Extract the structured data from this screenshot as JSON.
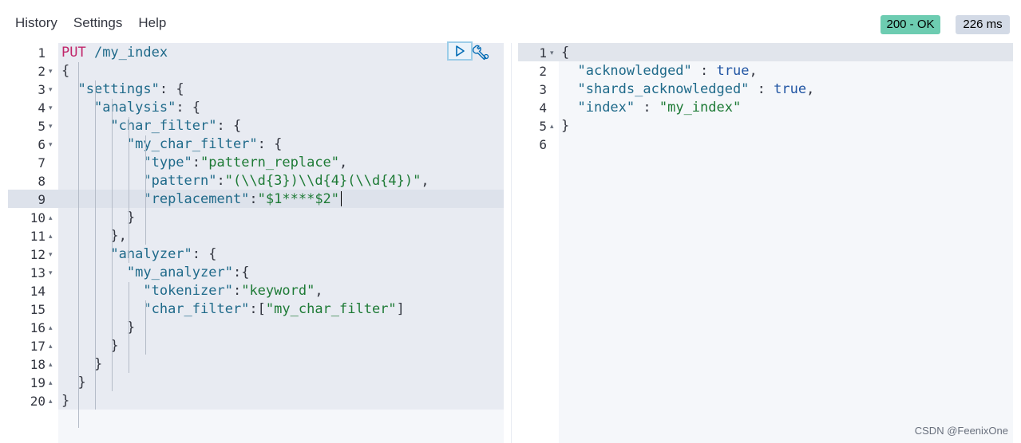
{
  "menu": {
    "items": [
      "History",
      "Settings",
      "Help"
    ]
  },
  "status": {
    "code": "200 - OK",
    "time": "226 ms",
    "ok_color": "#6dccb1"
  },
  "request": {
    "lines": [
      {
        "n": "1",
        "fold": "",
        "tokens": [
          [
            "kw",
            "PUT "
          ],
          [
            "key",
            "/my_index"
          ]
        ]
      },
      {
        "n": "2",
        "fold": "▾",
        "tokens": [
          [
            "pun",
            "{"
          ]
        ]
      },
      {
        "n": "3",
        "fold": "▾",
        "tokens": [
          [
            "pun",
            "  "
          ],
          [
            "key",
            "\"settings\""
          ],
          [
            "pun",
            ": {"
          ]
        ]
      },
      {
        "n": "4",
        "fold": "▾",
        "tokens": [
          [
            "pun",
            "    "
          ],
          [
            "key",
            "\"analysis\""
          ],
          [
            "pun",
            ": {"
          ]
        ]
      },
      {
        "n": "5",
        "fold": "▾",
        "tokens": [
          [
            "pun",
            "      "
          ],
          [
            "key",
            "\"char_filter\""
          ],
          [
            "pun",
            ": {"
          ]
        ]
      },
      {
        "n": "6",
        "fold": "▾",
        "tokens": [
          [
            "pun",
            "        "
          ],
          [
            "key",
            "\"my_char_filter\""
          ],
          [
            "pun",
            ": {"
          ]
        ]
      },
      {
        "n": "7",
        "fold": "",
        "tokens": [
          [
            "pun",
            "          "
          ],
          [
            "key",
            "\"type\""
          ],
          [
            "pun",
            ":"
          ],
          [
            "str",
            "\"pattern_replace\""
          ],
          [
            "pun",
            ","
          ]
        ]
      },
      {
        "n": "8",
        "fold": "",
        "tokens": [
          [
            "pun",
            "          "
          ],
          [
            "key",
            "\"pattern\""
          ],
          [
            "pun",
            ":"
          ],
          [
            "str",
            "\"(\\\\d{3})\\\\d{4}(\\\\d{4})\""
          ],
          [
            "pun",
            ","
          ]
        ]
      },
      {
        "n": "9",
        "fold": "",
        "tokens": [
          [
            "pun",
            "          "
          ],
          [
            "key",
            "\"replacement\""
          ],
          [
            "pun",
            ":"
          ],
          [
            "str",
            "\"$1****$2\""
          ]
        ]
      },
      {
        "n": "10",
        "fold": "▴",
        "tokens": [
          [
            "pun",
            "        }"
          ]
        ]
      },
      {
        "n": "11",
        "fold": "▴",
        "tokens": [
          [
            "pun",
            "      },"
          ]
        ]
      },
      {
        "n": "12",
        "fold": "▾",
        "tokens": [
          [
            "pun",
            "      "
          ],
          [
            "key",
            "\"analyzer\""
          ],
          [
            "pun",
            ": {"
          ]
        ]
      },
      {
        "n": "13",
        "fold": "▾",
        "tokens": [
          [
            "pun",
            "        "
          ],
          [
            "key",
            "\"my_analyzer\""
          ],
          [
            "pun",
            ":{"
          ]
        ]
      },
      {
        "n": "14",
        "fold": "",
        "tokens": [
          [
            "pun",
            "          "
          ],
          [
            "key",
            "\"tokenizer\""
          ],
          [
            "pun",
            ":"
          ],
          [
            "str",
            "\"keyword\""
          ],
          [
            "pun",
            ","
          ]
        ]
      },
      {
        "n": "15",
        "fold": "",
        "tokens": [
          [
            "pun",
            "          "
          ],
          [
            "key",
            "\"char_filter\""
          ],
          [
            "pun",
            ":["
          ],
          [
            "str",
            "\"my_char_filter\""
          ],
          [
            "pun",
            "]"
          ]
        ]
      },
      {
        "n": "16",
        "fold": "▴",
        "tokens": [
          [
            "pun",
            "        }"
          ]
        ]
      },
      {
        "n": "17",
        "fold": "▴",
        "tokens": [
          [
            "pun",
            "      }"
          ]
        ]
      },
      {
        "n": "18",
        "fold": "▴",
        "tokens": [
          [
            "pun",
            "    }"
          ]
        ]
      },
      {
        "n": "19",
        "fold": "▴",
        "tokens": [
          [
            "pun",
            "  }"
          ]
        ]
      },
      {
        "n": "20",
        "fold": "▴",
        "tokens": [
          [
            "pun",
            "}"
          ]
        ]
      }
    ]
  },
  "response": {
    "lines": [
      {
        "n": "1",
        "fold": "▾",
        "tokens": [
          [
            "pun",
            "{"
          ]
        ]
      },
      {
        "n": "2",
        "fold": "",
        "tokens": [
          [
            "pun",
            "  "
          ],
          [
            "key",
            "\"acknowledged\""
          ],
          [
            "pun",
            " : "
          ],
          [
            "bool",
            "true"
          ],
          [
            "pun",
            ","
          ]
        ]
      },
      {
        "n": "3",
        "fold": "",
        "tokens": [
          [
            "pun",
            "  "
          ],
          [
            "key",
            "\"shards_acknowledged\""
          ],
          [
            "pun",
            " : "
          ],
          [
            "bool",
            "true"
          ],
          [
            "pun",
            ","
          ]
        ]
      },
      {
        "n": "4",
        "fold": "",
        "tokens": [
          [
            "pun",
            "  "
          ],
          [
            "key",
            "\"index\""
          ],
          [
            "pun",
            " : "
          ],
          [
            "str",
            "\"my_index\""
          ]
        ]
      },
      {
        "n": "5",
        "fold": "▴",
        "tokens": [
          [
            "pun",
            "}"
          ]
        ]
      },
      {
        "n": "6",
        "fold": "",
        "tokens": []
      }
    ]
  },
  "icons": {
    "run": "play-icon",
    "settings": "wrench-icon"
  },
  "watermark": "CSDN @FeenixOne"
}
